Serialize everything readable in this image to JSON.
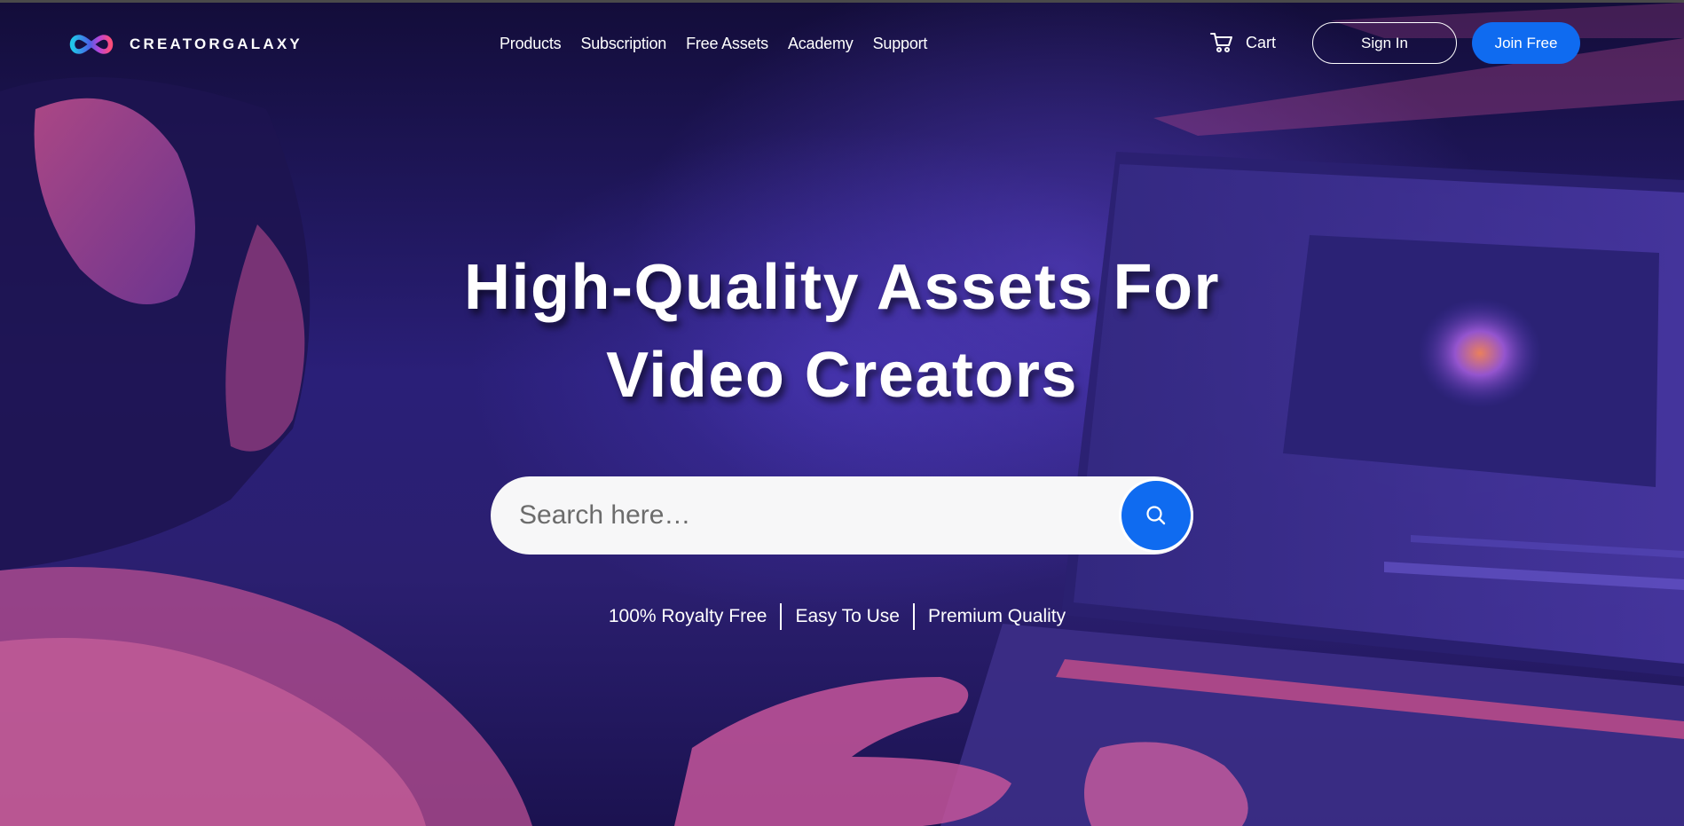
{
  "brand": {
    "name": "CREATORGALAXY",
    "logo_icon": "infinity-icon"
  },
  "nav": {
    "items": [
      {
        "label": "Products"
      },
      {
        "label": "Subscription"
      },
      {
        "label": "Free Assets"
      },
      {
        "label": "Academy"
      },
      {
        "label": "Support"
      }
    ]
  },
  "header": {
    "cart_label": "Cart",
    "cart_icon": "cart-icon",
    "signin_label": "Sign In",
    "join_label": "Join Free"
  },
  "hero": {
    "headline_line1": "High-Quality Assets For",
    "headline_line2": "Video Creators"
  },
  "search": {
    "placeholder": "Search here…",
    "value": "",
    "button_icon": "search-icon"
  },
  "features": [
    {
      "label": "100% Royalty Free"
    },
    {
      "label": "Easy To Use"
    },
    {
      "label": "Premium Quality"
    }
  ],
  "colors": {
    "accent": "#0f6bf0",
    "background_dark": "#130d3a",
    "background_mid": "#2a1f78",
    "highlight_pink": "#c8508f"
  }
}
